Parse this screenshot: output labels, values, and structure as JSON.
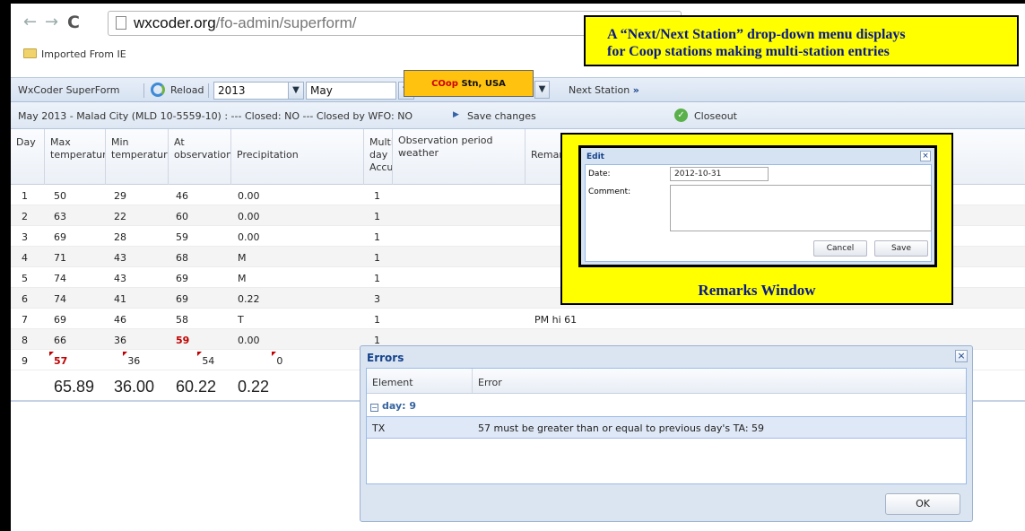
{
  "browser": {
    "url_host": "wxcoder.org",
    "url_path": "/fo-admin/superform/",
    "bookmark": "Imported From IE"
  },
  "toolbar": {
    "app_name": "WxCoder SuperForm",
    "reload": "Reload",
    "year": "2013",
    "month": "May",
    "station_prefix": "COop",
    "station_rest": " Stn, USA",
    "next_station": "Next Station",
    "next_arrows": "»"
  },
  "status": {
    "text": "May 2013 - Malad City (MLD 10-5559-10) : --- Closed: NO --- Closed by WFO: NO",
    "save_changes": "Save changes",
    "closeout": "Closeout"
  },
  "grid": {
    "headers": {
      "day": "Day",
      "max": "Max temperatur",
      "min": "Min temperatur",
      "at": "At observation",
      "precip": "Precipitation",
      "multi": "Multi-day Accumu",
      "obs": "Observation period weather",
      "remarks": "Remarks"
    },
    "rows": [
      {
        "day": "1",
        "max": "50",
        "min": "29",
        "at": "46",
        "prec": "0.00",
        "multi": "1",
        "remark": ""
      },
      {
        "day": "2",
        "max": "63",
        "min": "22",
        "at": "60",
        "prec": "0.00",
        "multi": "1",
        "remark": ""
      },
      {
        "day": "3",
        "max": "69",
        "min": "28",
        "at": "59",
        "prec": "0.00",
        "multi": "1",
        "remark": ""
      },
      {
        "day": "4",
        "max": "71",
        "min": "43",
        "at": "68",
        "prec": "M",
        "multi": "1",
        "remark": ""
      },
      {
        "day": "5",
        "max": "74",
        "min": "43",
        "at": "69",
        "prec": "M",
        "multi": "1",
        "remark": ""
      },
      {
        "day": "6",
        "max": "74",
        "min": "41",
        "at": "69",
        "prec": "0.22",
        "multi": "3",
        "remark": ""
      },
      {
        "day": "7",
        "max": "69",
        "min": "46",
        "at": "58",
        "prec": "T",
        "multi": "1",
        "remark": "PM hi 61"
      },
      {
        "day": "8",
        "max": "66",
        "min": "36",
        "at": "59",
        "prec": "0.00",
        "multi": "1",
        "remark": ""
      },
      {
        "day": "9",
        "max": "57",
        "min": "36",
        "at": "54",
        "prec": "0",
        "multi": "1",
        "remark": ""
      }
    ],
    "totals": {
      "max": "65.89",
      "min": "36.00",
      "at": "60.22",
      "prec": "0.22"
    }
  },
  "annotation": {
    "line1": "A “Next/Next Station” drop-down menu displays",
    "line2": "for Coop stations making multi-station entries"
  },
  "edit_dialog": {
    "title": "Edit",
    "close": "×",
    "date_label": "Date:",
    "date_value": "2012-10-31",
    "comment_label": "Comment:",
    "cancel": "Cancel",
    "save": "Save",
    "caption": "Remarks Window"
  },
  "errors_dialog": {
    "title": "Errors",
    "close": "×",
    "col_element": "Element",
    "col_error": "Error",
    "group_toggle": "−",
    "group": "day: 9",
    "element": "TX",
    "message": "57 must be greater than or equal to previous day's TA: 59",
    "ok": "OK"
  },
  "colors": {
    "annotation_bg": "#ffff00",
    "annotation_text": "#0a1a8a",
    "station_bg": "#ffc20e",
    "error_red": "#c00000",
    "panel_blue": "#dbe5f2"
  }
}
